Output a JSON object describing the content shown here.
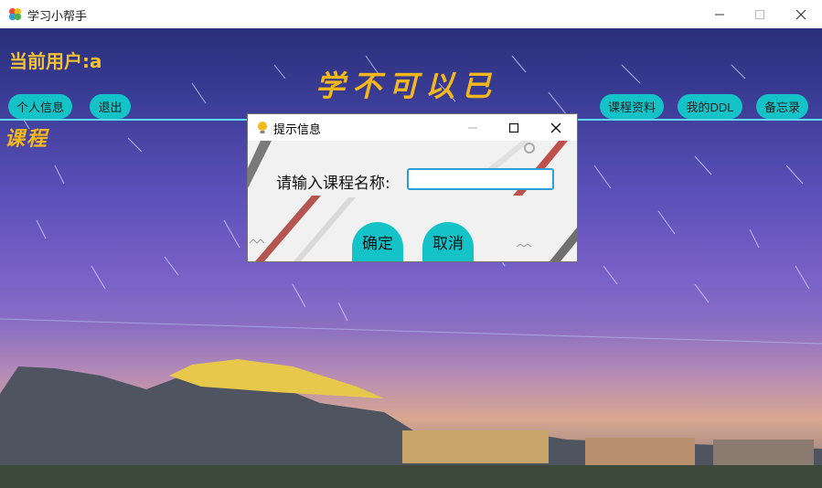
{
  "window": {
    "title": "学习小帮手"
  },
  "header": {
    "user_label": "当前用户:a",
    "motto": "学不可以已",
    "profile_button": "个人信息",
    "logout_button": "退出",
    "course_materials_button": "课程资料",
    "my_ddl_button": "我的DDL",
    "memo_button": "备忘录"
  },
  "section": {
    "title": "课程"
  },
  "dialog": {
    "title": "提示信息",
    "prompt": "请输入课程名称:",
    "input_value": "",
    "confirm_button": "确定",
    "cancel_button": "取消"
  },
  "colors": {
    "accent": "#13c3c8",
    "title_gold": "#f5b81c",
    "divider": "#5fd8ef",
    "input_border": "#2f9ed8"
  },
  "icons": {
    "app": "pinwheel-icon",
    "dialog": "lightbulb-icon"
  }
}
